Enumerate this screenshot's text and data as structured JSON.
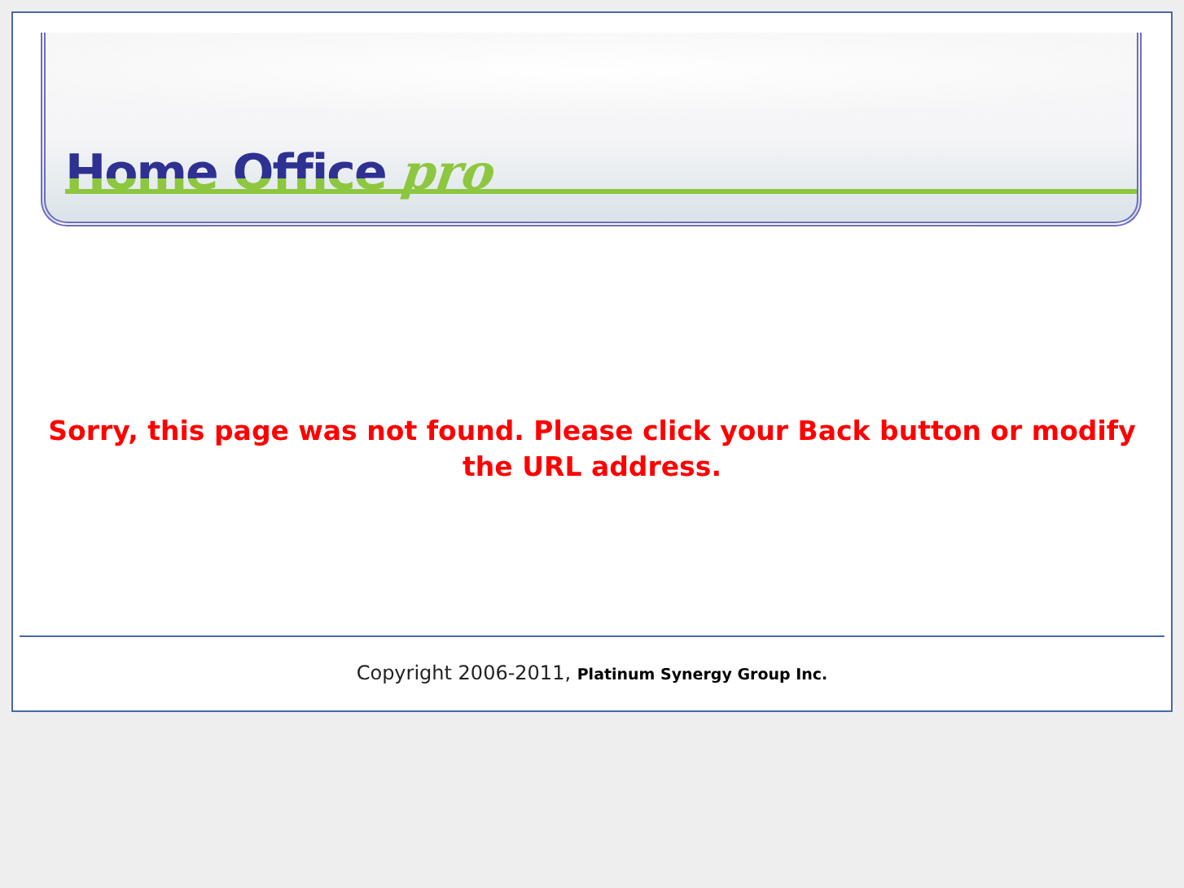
{
  "header": {
    "logo_main": "Home Office",
    "logo_suffix": "pro"
  },
  "message": "Sorry, this page was not found. Please click your Back button or modify the URL address.",
  "footer": {
    "copyright": "Copyright 2006-2011, **Platinum Synergy Group Inc.**"
  }
}
